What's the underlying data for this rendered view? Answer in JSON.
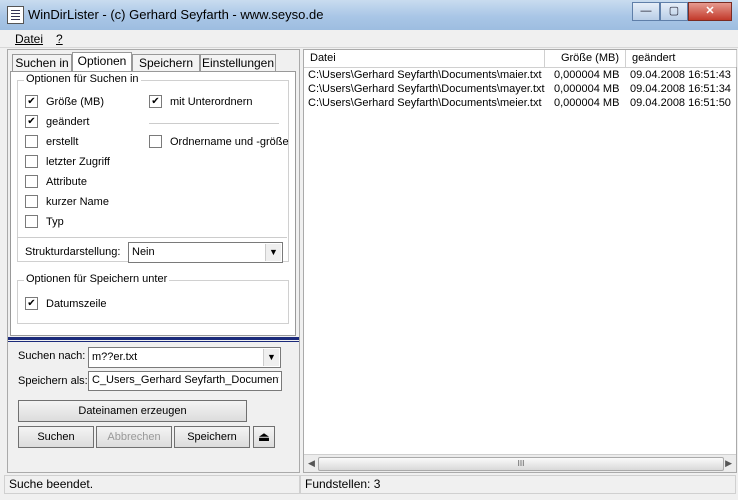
{
  "window": {
    "title": "WinDirLister - (c) Gerhard Seyfarth - www.seyso.de",
    "minimize_label": "—",
    "maximize_label": "▢",
    "close_label": "✕"
  },
  "menu": {
    "items": [
      "Datei",
      "?"
    ]
  },
  "tabs": [
    "Suchen in",
    "Optionen",
    "Speichern in",
    "Einstellungen"
  ],
  "options": {
    "group_title": "Optionen für Suchen in",
    "checks_left": [
      {
        "label": "Größe (MB)",
        "checked": true
      },
      {
        "label": "geändert",
        "checked": true
      },
      {
        "label": "erstellt",
        "checked": false
      },
      {
        "label": "letzter Zugriff",
        "checked": false
      },
      {
        "label": "Attribute",
        "checked": false
      },
      {
        "label": "kurzer Name",
        "checked": false
      },
      {
        "label": "Typ",
        "checked": false
      }
    ],
    "checks_right": [
      {
        "label": "mit Unterordnern",
        "checked": true
      },
      {
        "label": "Ordnername und -größe",
        "checked": false
      }
    ],
    "structure_label": "Strukturdarstellung:",
    "structure_value": "Nein",
    "save_group_title": "Optionen für Speichern unter",
    "save_checks": [
      {
        "label": "Datumszeile",
        "checked": true
      }
    ]
  },
  "search": {
    "search_label": "Suchen nach:",
    "search_value": "m??er.txt",
    "save_as_label": "Speichern als:",
    "save_as_value": "C_Users_Gerhard Seyfarth_Documents",
    "generate_button": "Dateinamen erzeugen",
    "buttons": [
      "Suchen",
      "Abbrechen",
      "Speichern"
    ],
    "eject_icon": "⏏"
  },
  "table": {
    "columns": [
      "Datei",
      "Größe (MB)",
      "geändert"
    ],
    "rows": [
      [
        "C:\\Users\\Gerhard Seyfarth\\Documents\\maier.txt",
        "0,000004 MB",
        "09.04.2008 16:51:43"
      ],
      [
        "C:\\Users\\Gerhard Seyfarth\\Documents\\mayer.txt",
        "0,000004 MB",
        "09.04.2008 16:51:34"
      ],
      [
        "C:\\Users\\Gerhard Seyfarth\\Documents\\meier.txt",
        "0,000004 MB",
        "09.04.2008 16:51:50"
      ]
    ]
  },
  "status": {
    "left": "Suche beendet.",
    "right": "Fundstellen: 3"
  }
}
